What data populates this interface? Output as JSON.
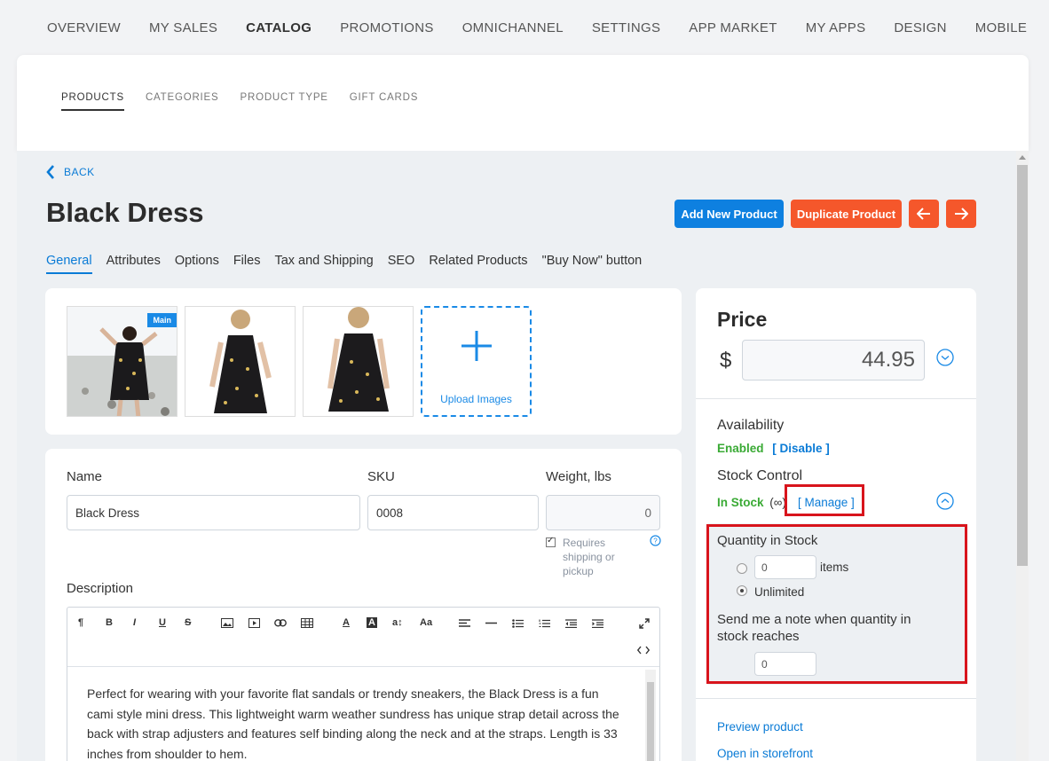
{
  "topnav": {
    "items": [
      "OVERVIEW",
      "MY SALES",
      "CATALOG",
      "PROMOTIONS",
      "OMNICHANNEL",
      "SETTINGS",
      "APP MARKET",
      "MY APPS",
      "DESIGN",
      "MOBILE"
    ]
  },
  "subnav": {
    "items": [
      "PRODUCTS",
      "CATEGORIES",
      "PRODUCT TYPE",
      "GIFT CARDS"
    ]
  },
  "back_label": "BACK",
  "product": {
    "title": "Black Dress",
    "add_new_label": "Add New Product",
    "duplicate_label": "Duplicate Product"
  },
  "tabs": [
    "General",
    "Attributes",
    "Options",
    "Files",
    "Tax and Shipping",
    "SEO",
    "Related Products",
    "\"Buy Now\" button"
  ],
  "images": {
    "main_badge": "Main",
    "upload_label": "Upload Images"
  },
  "form": {
    "name_label": "Name",
    "name_value": "Black Dress",
    "sku_label": "SKU",
    "sku_value": "0008",
    "weight_label": "Weight, lbs",
    "weight_value": "0",
    "requires_shipping": "Requires shipping or pickup",
    "description_label": "Description",
    "description_text": "Perfect for wearing with your favorite flat sandals or trendy sneakers, the Black Dress is a fun cami style mini dress. This lightweight warm weather sundress has unique strap detail across the back with strap adjusters and features self binding along the neck and at the straps. Length is 33 inches from shoulder to hem."
  },
  "price": {
    "title": "Price",
    "currency": "$",
    "value": "44.95"
  },
  "availability": {
    "label": "Availability",
    "status": "Enabled",
    "toggle_link": "[ Disable ]"
  },
  "stock": {
    "label": "Stock Control",
    "status": "In Stock",
    "infinity": "(∞)",
    "manage_link": "[ Manage ]",
    "quantity_title": "Quantity in Stock",
    "quantity_value": "0",
    "items_label": "items",
    "unlimited_label": "Unlimited",
    "note_label": "Send me a note when quantity in stock reaches",
    "note_value": "0"
  },
  "links": {
    "preview": "Preview product",
    "storefront": "Open in storefront"
  },
  "colors": {
    "accent_blue": "#0e80e0",
    "accent_orange": "#f5572b",
    "highlight_red": "#d8141c",
    "enabled_green": "#3aaa35"
  }
}
